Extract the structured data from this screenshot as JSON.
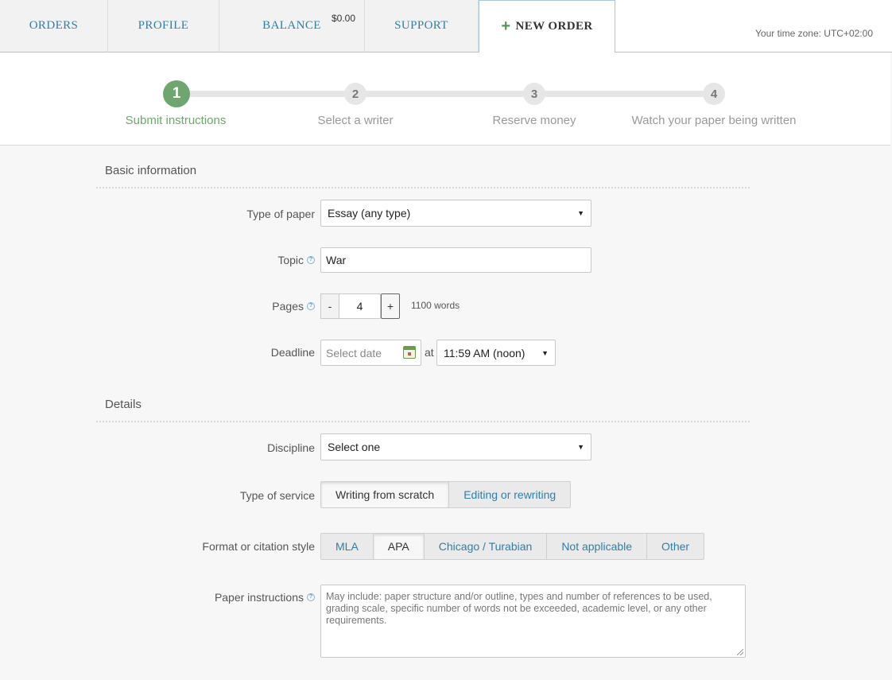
{
  "nav": {
    "tabs": [
      {
        "label": "ORDERS"
      },
      {
        "label": "PROFILE"
      },
      {
        "label": "BALANCE"
      },
      {
        "label": "SUPPORT"
      },
      {
        "label": "NEW ORDER"
      }
    ],
    "balance_amount": "$0.00",
    "timezone": "Your time zone: UTC+02:00"
  },
  "steps": [
    {
      "number": "1",
      "label": "Submit instructions",
      "state": "active"
    },
    {
      "number": "2",
      "label": "Select a writer",
      "state": "idle"
    },
    {
      "number": "3",
      "label": "Reserve money",
      "state": "idle"
    },
    {
      "number": "4",
      "label": "Watch your paper being written",
      "state": "idle"
    }
  ],
  "basic": {
    "title": "Basic information",
    "type_of_paper": {
      "label": "Type of paper",
      "value": "Essay (any type)"
    },
    "topic": {
      "label": "Topic",
      "value": "War"
    },
    "pages": {
      "label": "Pages",
      "value": "4",
      "minus": "-",
      "plus": "+",
      "words": "1100 words"
    },
    "deadline": {
      "label": "Deadline",
      "date_placeholder": "Select date",
      "at": "at",
      "time": "11:59 AM (noon)"
    }
  },
  "details": {
    "title": "Details",
    "discipline": {
      "label": "Discipline",
      "value": "Select one"
    },
    "service": {
      "label": "Type of service",
      "options": [
        "Writing from scratch",
        "Editing or rewriting"
      ],
      "selected": "Writing from scratch"
    },
    "format": {
      "label": "Format or citation style",
      "options": [
        "MLA",
        "APA",
        "Chicago / Turabian",
        "Not applicable",
        "Other"
      ],
      "selected": "APA"
    },
    "instructions": {
      "label": "Paper instructions",
      "placeholder": "May include: paper structure and/or outline, types and number of references to be used, grading scale, specific number of words not be exceeded, academic level, or any other requirements."
    }
  },
  "colors": {
    "accent": "#2e7fa8",
    "step_active": "#6fa66f"
  }
}
